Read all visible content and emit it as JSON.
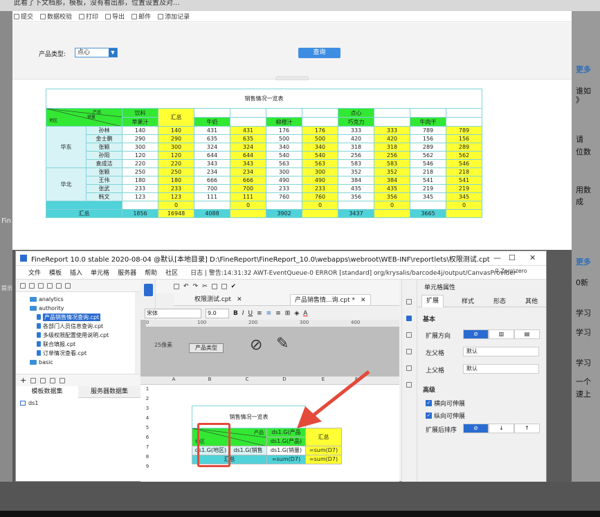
{
  "background": {
    "top_text": "此看了下文档那，模板，没有看出那，位置设置及对...",
    "left_strip_text": "Fin",
    "left_strip_text2": "提示",
    "right_panel": {
      "more1": "更多",
      "line1": "谁如",
      "line2": "》",
      "line3": "请",
      "line4": "位数",
      "line5": "用数",
      "line6": "成",
      "more2": "更多",
      "line7": "0新",
      "line8": "学习",
      "line9": "学习",
      "line10": "学习",
      "line11": "一个",
      "line12": "速上"
    }
  },
  "report": {
    "toolbar": [
      "提交",
      "数据校验",
      "打印",
      "导出",
      "邮件",
      "添加记录"
    ],
    "filter_label": "产品类型:",
    "filter_value": "点心",
    "query_button": "查询",
    "table_title": "销售情况一览表",
    "header_slash": {
      "top": "产品",
      "mid": "销量",
      "left": "地区"
    },
    "header_cat1": "饮料",
    "header_cat2": "点心",
    "header_summary": "汇总",
    "products": [
      "苹果汁",
      "牛奶",
      "柳橙汁",
      "巧克力",
      "牛肉干"
    ],
    "regions": [
      {
        "name": "华东",
        "rows": [
          {
            "name": "孙林",
            "v": [
              "140",
              "140",
              "431",
              "431",
              "176",
              "176",
              "333",
              "333",
              "789",
              "789"
            ]
          },
          {
            "name": "金士鹏",
            "v": [
              "290",
              "290",
              "635",
              "635",
              "500",
              "500",
              "420",
              "420",
              "156",
              "156"
            ]
          },
          {
            "name": "张颖",
            "v": [
              "300",
              "300",
              "324",
              "324",
              "340",
              "340",
              "318",
              "318",
              "289",
              "289"
            ]
          },
          {
            "name": "孙阳",
            "v": [
              "120",
              "120",
              "644",
              "644",
              "540",
              "540",
              "256",
              "256",
              "562",
              "562"
            ]
          },
          {
            "name": "袁成洁",
            "v": [
              "220",
              "220",
              "343",
              "343",
              "563",
              "563",
              "583",
              "583",
              "546",
              "546"
            ]
          }
        ]
      },
      {
        "name": "华北",
        "rows": [
          {
            "name": "张颖",
            "v": [
              "250",
              "250",
              "234",
              "234",
              "300",
              "300",
              "352",
              "352",
              "218",
              "218"
            ]
          },
          {
            "name": "王伟",
            "v": [
              "180",
              "180",
              "666",
              "666",
              "490",
              "490",
              "384",
              "384",
              "541",
              "541"
            ]
          },
          {
            "name": "张武",
            "v": [
              "233",
              "233",
              "700",
              "700",
              "233",
              "233",
              "435",
              "435",
              "219",
              "219"
            ]
          },
          {
            "name": "韩文",
            "v": [
              "123",
              "123",
              "111",
              "111",
              "760",
              "760",
              "356",
              "356",
              "345",
              "345"
            ]
          }
        ]
      }
    ],
    "zero_row": [
      "",
      "0",
      "",
      "0",
      "",
      "0",
      "",
      "0",
      "",
      "0"
    ],
    "total_label": "汇总",
    "total_row": [
      "1856",
      "16948",
      "4088",
      "",
      "3902",
      "",
      "3437",
      "",
      "3665",
      ""
    ]
  },
  "app": {
    "title": "FineReport 10.0 stable 2020-08-04 @默认[本地目录]   D:\\FineReport\\FineReport_10.0\\webapps\\webroot\\WEB-INF\\reportlets\\权限测试.cpt",
    "menu": [
      "文件",
      "模板",
      "插入",
      "单元格",
      "服务器",
      "帮助",
      "社区"
    ],
    "log_text": "日志 | 警告:14:31:32 AWT-EventQueue-0 ERROR [standard] org/krysalis/barcode4j/output/CanvasProvider",
    "search_text": "Zero\\zero",
    "tree": [
      {
        "label": "analytics",
        "type": "folder",
        "indent": 0
      },
      {
        "label": "authority",
        "type": "folder",
        "indent": 0
      },
      {
        "label": "产品销售情况查询.cpt",
        "type": "file",
        "indent": 1,
        "selected": true
      },
      {
        "label": "各部门人员信息查询.cpt",
        "type": "file",
        "indent": 1
      },
      {
        "label": "多级权限配置使用说明.cpt",
        "type": "file",
        "indent": 1
      },
      {
        "label": "联合填报.cpt",
        "type": "file",
        "indent": 1
      },
      {
        "label": "订单情况查看.cpt",
        "type": "file",
        "indent": 1
      },
      {
        "label": "basic",
        "type": "folder",
        "indent": 0
      }
    ],
    "ds_tabs": [
      "模板数据集",
      "服务器数据集"
    ],
    "ds_item": "ds1",
    "editor_tabs": [
      "权限测试.cpt",
      "产品销售情...询.cpt *"
    ],
    "font": "宋体",
    "font_size": "9.0",
    "ruler": [
      "0",
      "100",
      "200",
      "300",
      "400"
    ],
    "param_hint": "25像素",
    "param_label": "产品类型",
    "grid_cols": [
      "A",
      "B",
      "C",
      "D",
      "E",
      "F"
    ],
    "grid_rows": [
      "1",
      "2",
      "3",
      "4",
      "5",
      "6",
      "7",
      "8",
      "9"
    ],
    "grid": {
      "title": "销售情况一览表",
      "slash_top": "产品",
      "slash_bottom": "地区",
      "d5": "ds1.G(产品",
      "d6": "ds1.G(产品)",
      "e56": "汇总",
      "b7": "ds1.G(地区)",
      "c7": "ds1.G(销售",
      "d7": "ds1.G(销量)",
      "e7": "=sum(D7)",
      "b8": "汇总",
      "d8": "=sum(D7)",
      "e8": "=sum(D7)"
    },
    "props": {
      "title": "单元格属性",
      "tabs": [
        "扩展",
        "样式",
        "形态",
        "其他"
      ],
      "section_basic": "基本",
      "expand_dir": "扩展方向",
      "left_parent": "左父格",
      "left_parent_val": "默认",
      "top_parent": "上父格",
      "top_parent_val": "默认",
      "section_adv": "高级",
      "cb1": "横向可伸展",
      "cb2": "纵向可伸展",
      "sort": "扩展后排序"
    }
  },
  "colors": {
    "green": "#33e833",
    "yellow": "#ffff33",
    "cyan": "#4fd2d8",
    "accent": "#2a6bd1",
    "red": "#e34a3a"
  }
}
